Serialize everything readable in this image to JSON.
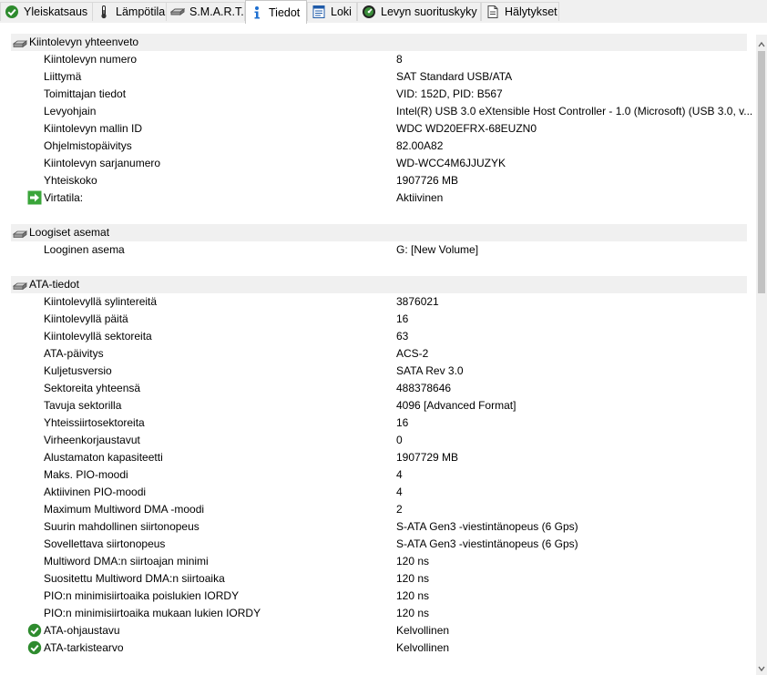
{
  "tabs": [
    {
      "label": "Yleiskatsaus",
      "icon": "check-circle-icon"
    },
    {
      "label": "Lämpötila",
      "icon": "thermometer-icon"
    },
    {
      "label": "S.M.A.R.T.",
      "icon": "disk-icon"
    },
    {
      "label": "Tiedot",
      "icon": "info-icon"
    },
    {
      "label": "Loki",
      "icon": "log-icon"
    },
    {
      "label": "Levyn suorituskyky",
      "icon": "gauge-icon"
    },
    {
      "label": "Hälytykset",
      "icon": "alert-document-icon"
    }
  ],
  "active_tab": "Tiedot",
  "colors": {
    "section_bg": "#f0f0f0",
    "check_green": "#2e8b2e",
    "arrow_green": "#3aa53a",
    "info_blue": "#1e6fd0"
  },
  "sections": [
    {
      "title": "Kiintolevyn yhteenveto",
      "rows": [
        {
          "label": "Kiintolevyn numero",
          "value": "8"
        },
        {
          "label": "Liittymä",
          "value": "SAT Standard USB/ATA"
        },
        {
          "label": "Toimittajan tiedot",
          "value": "VID: 152D, PID: B567"
        },
        {
          "label": "Levyohjain",
          "value": "Intel(R) USB 3.0 eXtensible Host Controller - 1.0 (Microsoft) (USB 3.0, v..."
        },
        {
          "label": "Kiintolevyn mallin ID",
          "value": "WDC WD20EFRX-68EUZN0"
        },
        {
          "label": "Ohjelmistopäivitys",
          "value": "82.00A82"
        },
        {
          "label": "Kiintolevyn sarjanumero",
          "value": "WD-WCC4M6JJUZYK"
        },
        {
          "label": "Yhteiskoko",
          "value": "1907726 MB"
        },
        {
          "label": "Virtatila:",
          "value": "Aktiivinen",
          "icon": "green-arrow-icon"
        }
      ]
    },
    {
      "title": "Loogiset asemat",
      "rows": [
        {
          "label": "Looginen asema",
          "value": "G: [New Volume]"
        }
      ]
    },
    {
      "title": "ATA-tiedot",
      "rows": [
        {
          "label": "Kiintolevyllä sylintereitä",
          "value": "3876021"
        },
        {
          "label": "Kiintolevyllä päitä",
          "value": "16"
        },
        {
          "label": "Kiintolevyllä sektoreita",
          "value": "63"
        },
        {
          "label": "ATA-päivitys",
          "value": "ACS-2"
        },
        {
          "label": "Kuljetusversio",
          "value": "SATA Rev 3.0"
        },
        {
          "label": "Sektoreita yhteensä",
          "value": "488378646"
        },
        {
          "label": "Tavuja sektorilla",
          "value": "4096 [Advanced Format]"
        },
        {
          "label": "Yhteissiirtosektoreita",
          "value": "16"
        },
        {
          "label": "Virheenkorjaustavut",
          "value": "0"
        },
        {
          "label": "Alustamaton kapasiteetti",
          "value": "1907729 MB"
        },
        {
          "label": "Maks. PIO-moodi",
          "value": "4"
        },
        {
          "label": "Aktiivinen PIO-moodi",
          "value": "4"
        },
        {
          "label": "Maximum Multiword DMA -moodi",
          "value": "2"
        },
        {
          "label": "Suurin mahdollinen siirtonopeus",
          "value": "S-ATA Gen3 -viestintänopeus (6 Gps)"
        },
        {
          "label": "Sovellettava siirtonopeus",
          "value": "S-ATA Gen3 -viestintänopeus (6 Gps)"
        },
        {
          "label": "Multiword DMA:n siirtoajan minimi",
          "value": "120 ns"
        },
        {
          "label": "Suositettu Multiword DMA:n siirtoaika",
          "value": "120 ns"
        },
        {
          "label": "PIO:n minimisiirtoaika poislukien IORDY",
          "value": "120 ns"
        },
        {
          "label": "PIO:n minimisiirtoaika mukaan lukien IORDY",
          "value": "120 ns"
        },
        {
          "label": "ATA-ohjaustavu",
          "value": "Kelvollinen",
          "icon": "check-circle-icon"
        },
        {
          "label": "ATA-tarkistearvo",
          "value": "Kelvollinen",
          "icon": "check-circle-icon"
        }
      ]
    }
  ]
}
